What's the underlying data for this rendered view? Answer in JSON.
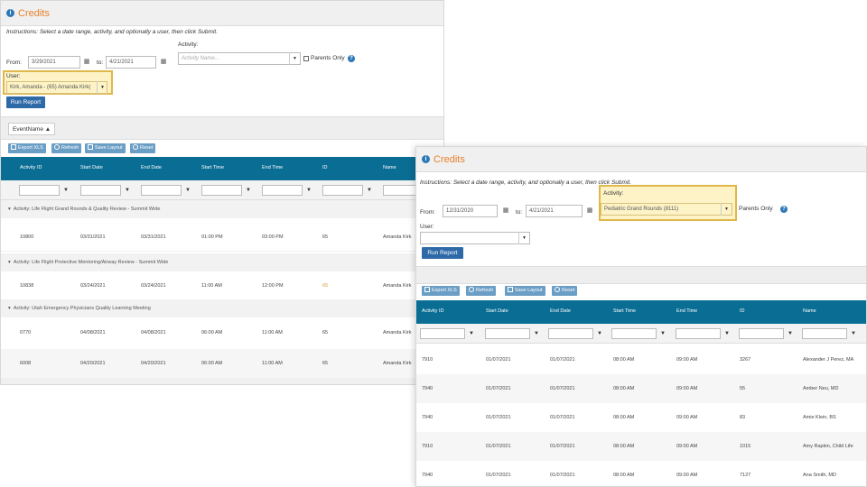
{
  "colors": {
    "accent": "#e8812b",
    "header": "#0a6d94",
    "highlight": "#e0b84a",
    "button": "#2f6aa8"
  },
  "p1": {
    "title": "Credits",
    "title_icon": "circle-info-icon",
    "instructions": "Instructions: Select a date range, activity, and optionally a user, then click Submit.",
    "activity_label": "Activity:",
    "activity_placeholder": "Activity Name...",
    "parents_only": "Parents Only",
    "from_label": "From:",
    "from_value": "3/29/2021",
    "to_label": "to:",
    "to_value": "4/21/2021",
    "user_label": "User:",
    "user_value": "Kirk, Amanda - (65) Amanda Kirk(",
    "run_report": "Run Report",
    "group_chip": "EventName",
    "toolbar": [
      "Export XLS",
      "Refresh",
      "Save Layout",
      "Reset"
    ],
    "columns": [
      "Activity ID",
      "Start Date",
      "End Date",
      "Start Time",
      "End Time",
      "ID",
      "Name"
    ],
    "groups": [
      {
        "label": "Activity: Life Flight Grand Rounds & Quality Review - Summit Wide",
        "rows": [
          {
            "cells": [
              "10800",
              "03/31/2021",
              "03/31/2021",
              "01:00 PM",
              "03:00 PM",
              "65",
              "Amanda Kirk"
            ]
          }
        ]
      },
      {
        "label": "Activity: Life Flight Protective Mentoring/Airway Review - Summit Wide",
        "rows": [
          {
            "cells": [
              "10838",
              "03/24/2021",
              "03/24/2021",
              "11:00 AM",
              "12:00 PM",
              "65",
              "Amanda Kirk"
            ]
          }
        ]
      },
      {
        "label": "Activity: Utah Emergency Physicians Quality Learning Meeting",
        "rows": [
          {
            "cells": [
              "0770",
              "04/08/2021",
              "04/08/2021",
              "06:00 AM",
              "11:00 AM",
              "65",
              "Amanda Kirk"
            ]
          },
          {
            "cells": [
              "6008",
              "04/20/2021",
              "04/20/2021",
              "06:00 AM",
              "11:00 AM",
              "65",
              "Amanda Kirk"
            ]
          }
        ]
      }
    ]
  },
  "p2": {
    "title": "Credits",
    "title_icon": "circle-info-icon",
    "instructions": "Instructions: Select a date range, activity, and optionally a user, then click Submit.",
    "activity_label": "Activity:",
    "activity_value": "Pediatric Grand Rounds (8111)",
    "parents_only": "Parents Only",
    "from_label": "From:",
    "from_value": "12/31/2020",
    "to_label": "to:",
    "to_value": "4/21/2021",
    "user_label": "User:",
    "user_value": "",
    "run_report": "Run Report",
    "toolbar": [
      "Export XLS",
      "Refresh",
      "Save Layout",
      "Reset"
    ],
    "columns": [
      "Activity ID",
      "Start Date",
      "End Date",
      "Start Time",
      "End Time",
      "ID",
      "Name"
    ],
    "rows": [
      {
        "cells": [
          "7910",
          "01/07/2021",
          "01/07/2021",
          "08:00 AM",
          "09:00 AM",
          "3267",
          "Alexander J Perez, MA"
        ]
      },
      {
        "cells": [
          "7940",
          "01/07/2021",
          "01/07/2021",
          "08:00 AM",
          "09:00 AM",
          "55",
          "Amber Neu, MD"
        ]
      },
      {
        "cells": [
          "7940",
          "01/07/2021",
          "01/07/2021",
          "08:00 AM",
          "09:00 AM",
          "83",
          "Amie Klein, BS"
        ]
      },
      {
        "cells": [
          "7910",
          "01/07/2021",
          "01/07/2021",
          "08:00 AM",
          "09:00 AM",
          "1015",
          "Amy Rapkin, Child Life"
        ]
      },
      {
        "cells": [
          "7940",
          "01/07/2021",
          "01/07/2021",
          "08:00 AM",
          "09:00 AM",
          "7127",
          "Ana Smith, MD"
        ]
      }
    ]
  }
}
